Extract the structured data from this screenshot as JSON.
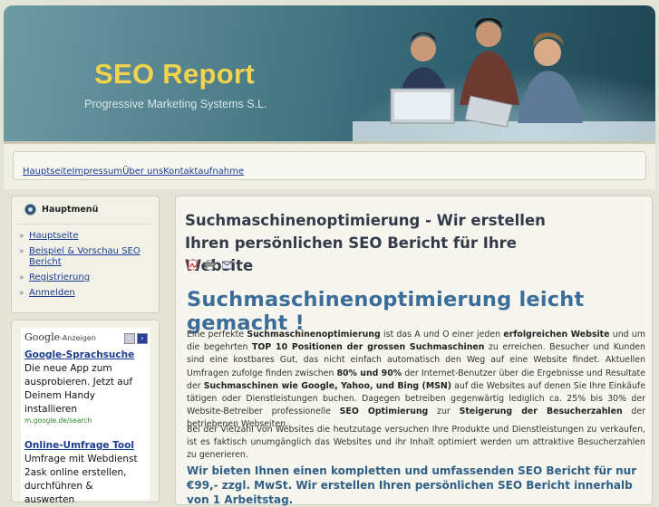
{
  "header": {
    "title": "SEO Report",
    "subtitle": "Progressive Marketing Systems S.L."
  },
  "nav": {
    "links": [
      "Hauptseite",
      "Impressum",
      "Über uns",
      "Kontaktaufnahme"
    ]
  },
  "mainmenu": {
    "title": "Hauptmenü",
    "items": [
      "Hauptseite",
      "Beispiel & Vorschau SEO Bericht",
      "Registrierung",
      "Anmelden"
    ]
  },
  "ads": {
    "google": "Google",
    "label": "-Anzeigen",
    "items": [
      {
        "title": "Google-Sprachsuche",
        "text": "Die neue App zum ausprobieren. Jetzt auf Deinem Handy installieren",
        "url": "m.google.de/search"
      },
      {
        "title": "Online-Umfrage Tool",
        "text": "Umfrage mit Webdienst 2ask online erstellen, durchführen & auswerten",
        "url": ""
      }
    ]
  },
  "article": {
    "title": "Suchmaschinenoptimierung - Wir erstellen Ihren persönlichen SEO Bericht für Ihre Website",
    "icons": [
      "pdf-icon",
      "print-icon",
      "email-icon"
    ],
    "heading": "Suchmaschinenoptimierung leicht gemacht !",
    "p1": [
      {
        "t": "Eine perfekte ",
        "b": false
      },
      {
        "t": "Suchmaschinenoptimierung",
        "b": true
      },
      {
        "t": " ist das A und O einer jeden ",
        "b": false
      },
      {
        "t": "erfolgreichen Website",
        "b": true
      },
      {
        "t": " und um die begehrten ",
        "b": false
      },
      {
        "t": "TOP 10 Positionen der grossen Suchmaschinen",
        "b": true
      },
      {
        "t": " zu erreichen. Besucher und Kunden sind eine kostbares Gut, das nicht einfach automatisch den Weg auf eine Website findet. Aktuellen Umfragen zufolge finden zwischen ",
        "b": false
      },
      {
        "t": "80% und 90%",
        "b": true
      },
      {
        "t": " der Internet-Benutzer über die Ergebnisse und Resultate der ",
        "b": false
      },
      {
        "t": "Suchmaschinen wie Google, Yahoo, und Bing (MSN)",
        "b": true
      },
      {
        "t": " auf die Websites auf denen Sie Ihre Einkäufe tätigen oder Dienstleistungen buchen. Dagegen betreiben gegenwärtig lediglich ca. 25% bis 30% der Website-Betreiber professionelle ",
        "b": false
      },
      {
        "t": "SEO Optimierung",
        "b": true
      },
      {
        "t": " zur ",
        "b": false
      },
      {
        "t": "Steigerung der Besucherzahlen",
        "b": true
      },
      {
        "t": " der betriebenen Webseiten.",
        "b": false
      }
    ],
    "p2": "Bei der Vielzahl von Websites die heutzutage versuchen Ihre Produkte und Dienstleistungen zu verkaufen, ist es faktisch unumgänglich das Websites und ihr Inhalt optimiert werden um attraktive Besucherzahlen zu generieren.",
    "cta": "Wir bieten Ihnen einen kompletten und umfassenden SEO Bericht für nur €99,- zzgl. MwSt. Wir erstellen Ihren persönlichen SEO Bericht innerhalb von 1 Arbeitstag."
  }
}
